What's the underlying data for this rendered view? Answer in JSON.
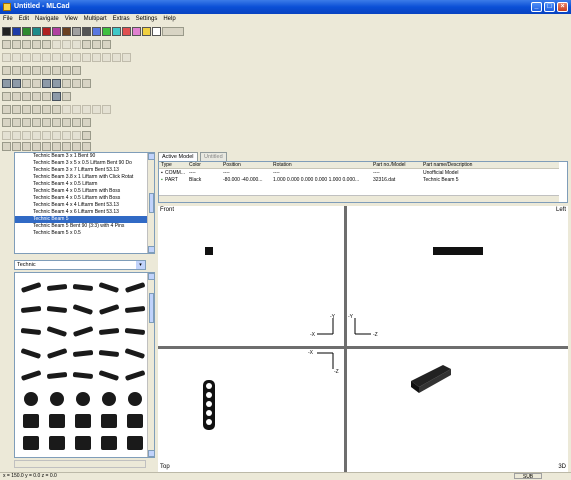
{
  "window": {
    "title": "Untitled - MLCad"
  },
  "menu": [
    "File",
    "Edit",
    "Navigate",
    "View",
    "Multipart",
    "Extras",
    "Settings",
    "Help"
  ],
  "colors": {
    "palette": [
      "#222222",
      "#1e3ca8",
      "#2f8a2f",
      "#1e8a8a",
      "#b02020",
      "#b040a0",
      "#6a4020",
      "#a0a0a0",
      "#555555",
      "#5a78e0",
      "#40c040",
      "#40c8c8",
      "#e05050",
      "#e080d0",
      "#f0d040",
      "#ffffff"
    ],
    "accent": "#316ac5"
  },
  "parts_list": {
    "items": [
      "Technic Beam 3 x 1 Bent 90",
      "Technic Beam 3 x 5 x 0.5 Liftarm Bent 90 Do",
      "Technic Beam 3 x 7 Liftarm Bent 53.13",
      "Technic Beam 3.8 x 1 Liftarm with Click Rotat",
      "Technic Beam 4 x 0.5 Liftarm",
      "Technic Beam 4 x 0.5 Liftarm with Boss",
      "Technic Beam 4 x 0.5 Liftarm with Boss",
      "Technic Beam 4 x 4 Liftarm Bent 53.13",
      "Technic Beam 4 x 6 Liftarm Bent 53.13",
      "Technic Beam 5",
      "Technic Beam 5 Bent 90 (3:3) with 4 Pins",
      "Technic Beam 5 x 0.5"
    ],
    "selected_index": 9
  },
  "category": {
    "value": "Technic"
  },
  "tabs": {
    "active": "Active Model",
    "inactive": "Untitled"
  },
  "model_table": {
    "headers": [
      "Type",
      "Color",
      "Position",
      "Rotation",
      "Part no./Model",
      "Part name/Description"
    ],
    "rows": [
      [
        "COMM...",
        "----",
        "----",
        "----",
        "----",
        "Unofficial Model"
      ],
      [
        "PART",
        "Black",
        "-80.000 -40.000...",
        "1.000 0.000 0.000 0.000 1.000 0.000...",
        "32316.dat",
        "Technic Beam 5"
      ]
    ]
  },
  "viewports": {
    "front": "Front",
    "left": "Left",
    "top": "Top",
    "threed": "3D"
  },
  "axes": {
    "y": "-Y",
    "x": "-X",
    "z": "-Z"
  },
  "status": {
    "coords": "x = 150.0 y = 0.0 z = 0.0",
    "mode": "SUB"
  }
}
